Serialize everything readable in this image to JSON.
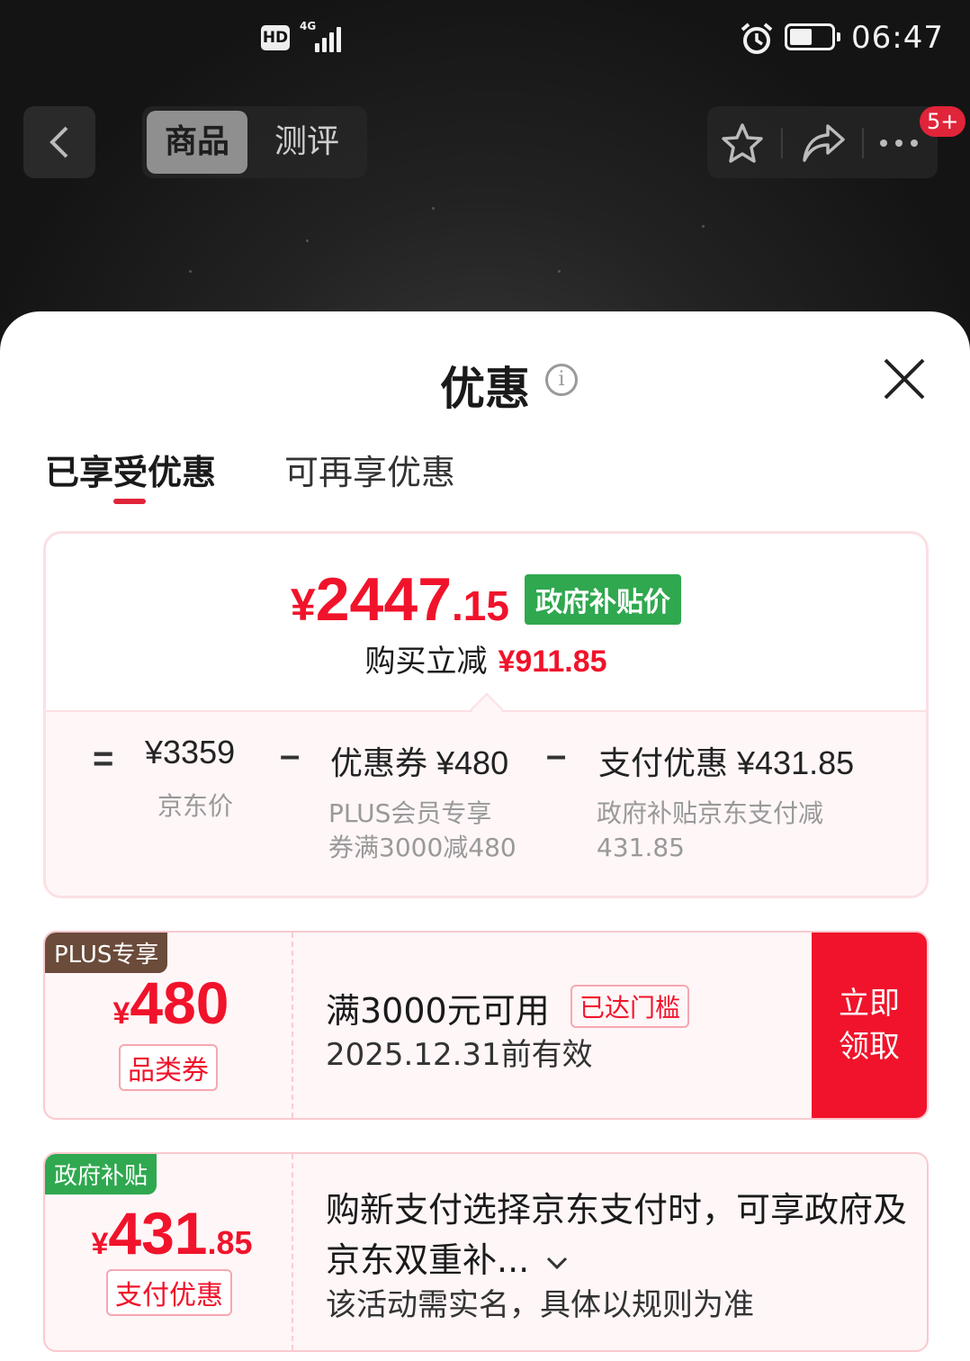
{
  "status_bar": {
    "hd": "HD",
    "network": "4G",
    "time": "06:47"
  },
  "nav": {
    "tabs": [
      "商品",
      "测评"
    ],
    "badge": "5+"
  },
  "sheet": {
    "title": "优惠",
    "tabs": [
      "已享受优惠",
      "可再享优惠"
    ]
  },
  "summary": {
    "currency": "¥",
    "price_int": "2447",
    "price_dec": ".15",
    "price_tag": "政府补贴价",
    "reduce_label": "购买立减",
    "reduce_amount": "¥911.85",
    "eq": "=",
    "minus": "–",
    "jd_price": "¥3359",
    "jd_price_label": "京东价",
    "coupon_part": "优惠券 ¥480",
    "coupon_sub1": "PLUS会员专享",
    "coupon_sub2": "券满3000减480",
    "pay_part": "支付优惠 ¥431.85",
    "pay_sub1": "政府补贴京东支付减",
    "pay_sub2": "431.85"
  },
  "coupons": [
    {
      "corner": "PLUS专享",
      "corner_color": "#6b4b3a",
      "currency": "¥",
      "amount": "480",
      "type": "品类券",
      "condition": "满3000元可用",
      "met": "已达门槛",
      "expire": "2025.12.31前有效",
      "action": "立即领取"
    },
    {
      "corner": "政府补贴",
      "corner_color": "#2fa84f",
      "currency": "¥",
      "amount": "431",
      "amount_dec": ".85",
      "type": "支付优惠",
      "desc": "购新支付选择京东支付时，可享政府及京东双重补...",
      "note": "该活动需实名，具体以规则为准"
    }
  ],
  "colors": {
    "accent_red": "#f0132b",
    "gov_green": "#2fa84f"
  }
}
